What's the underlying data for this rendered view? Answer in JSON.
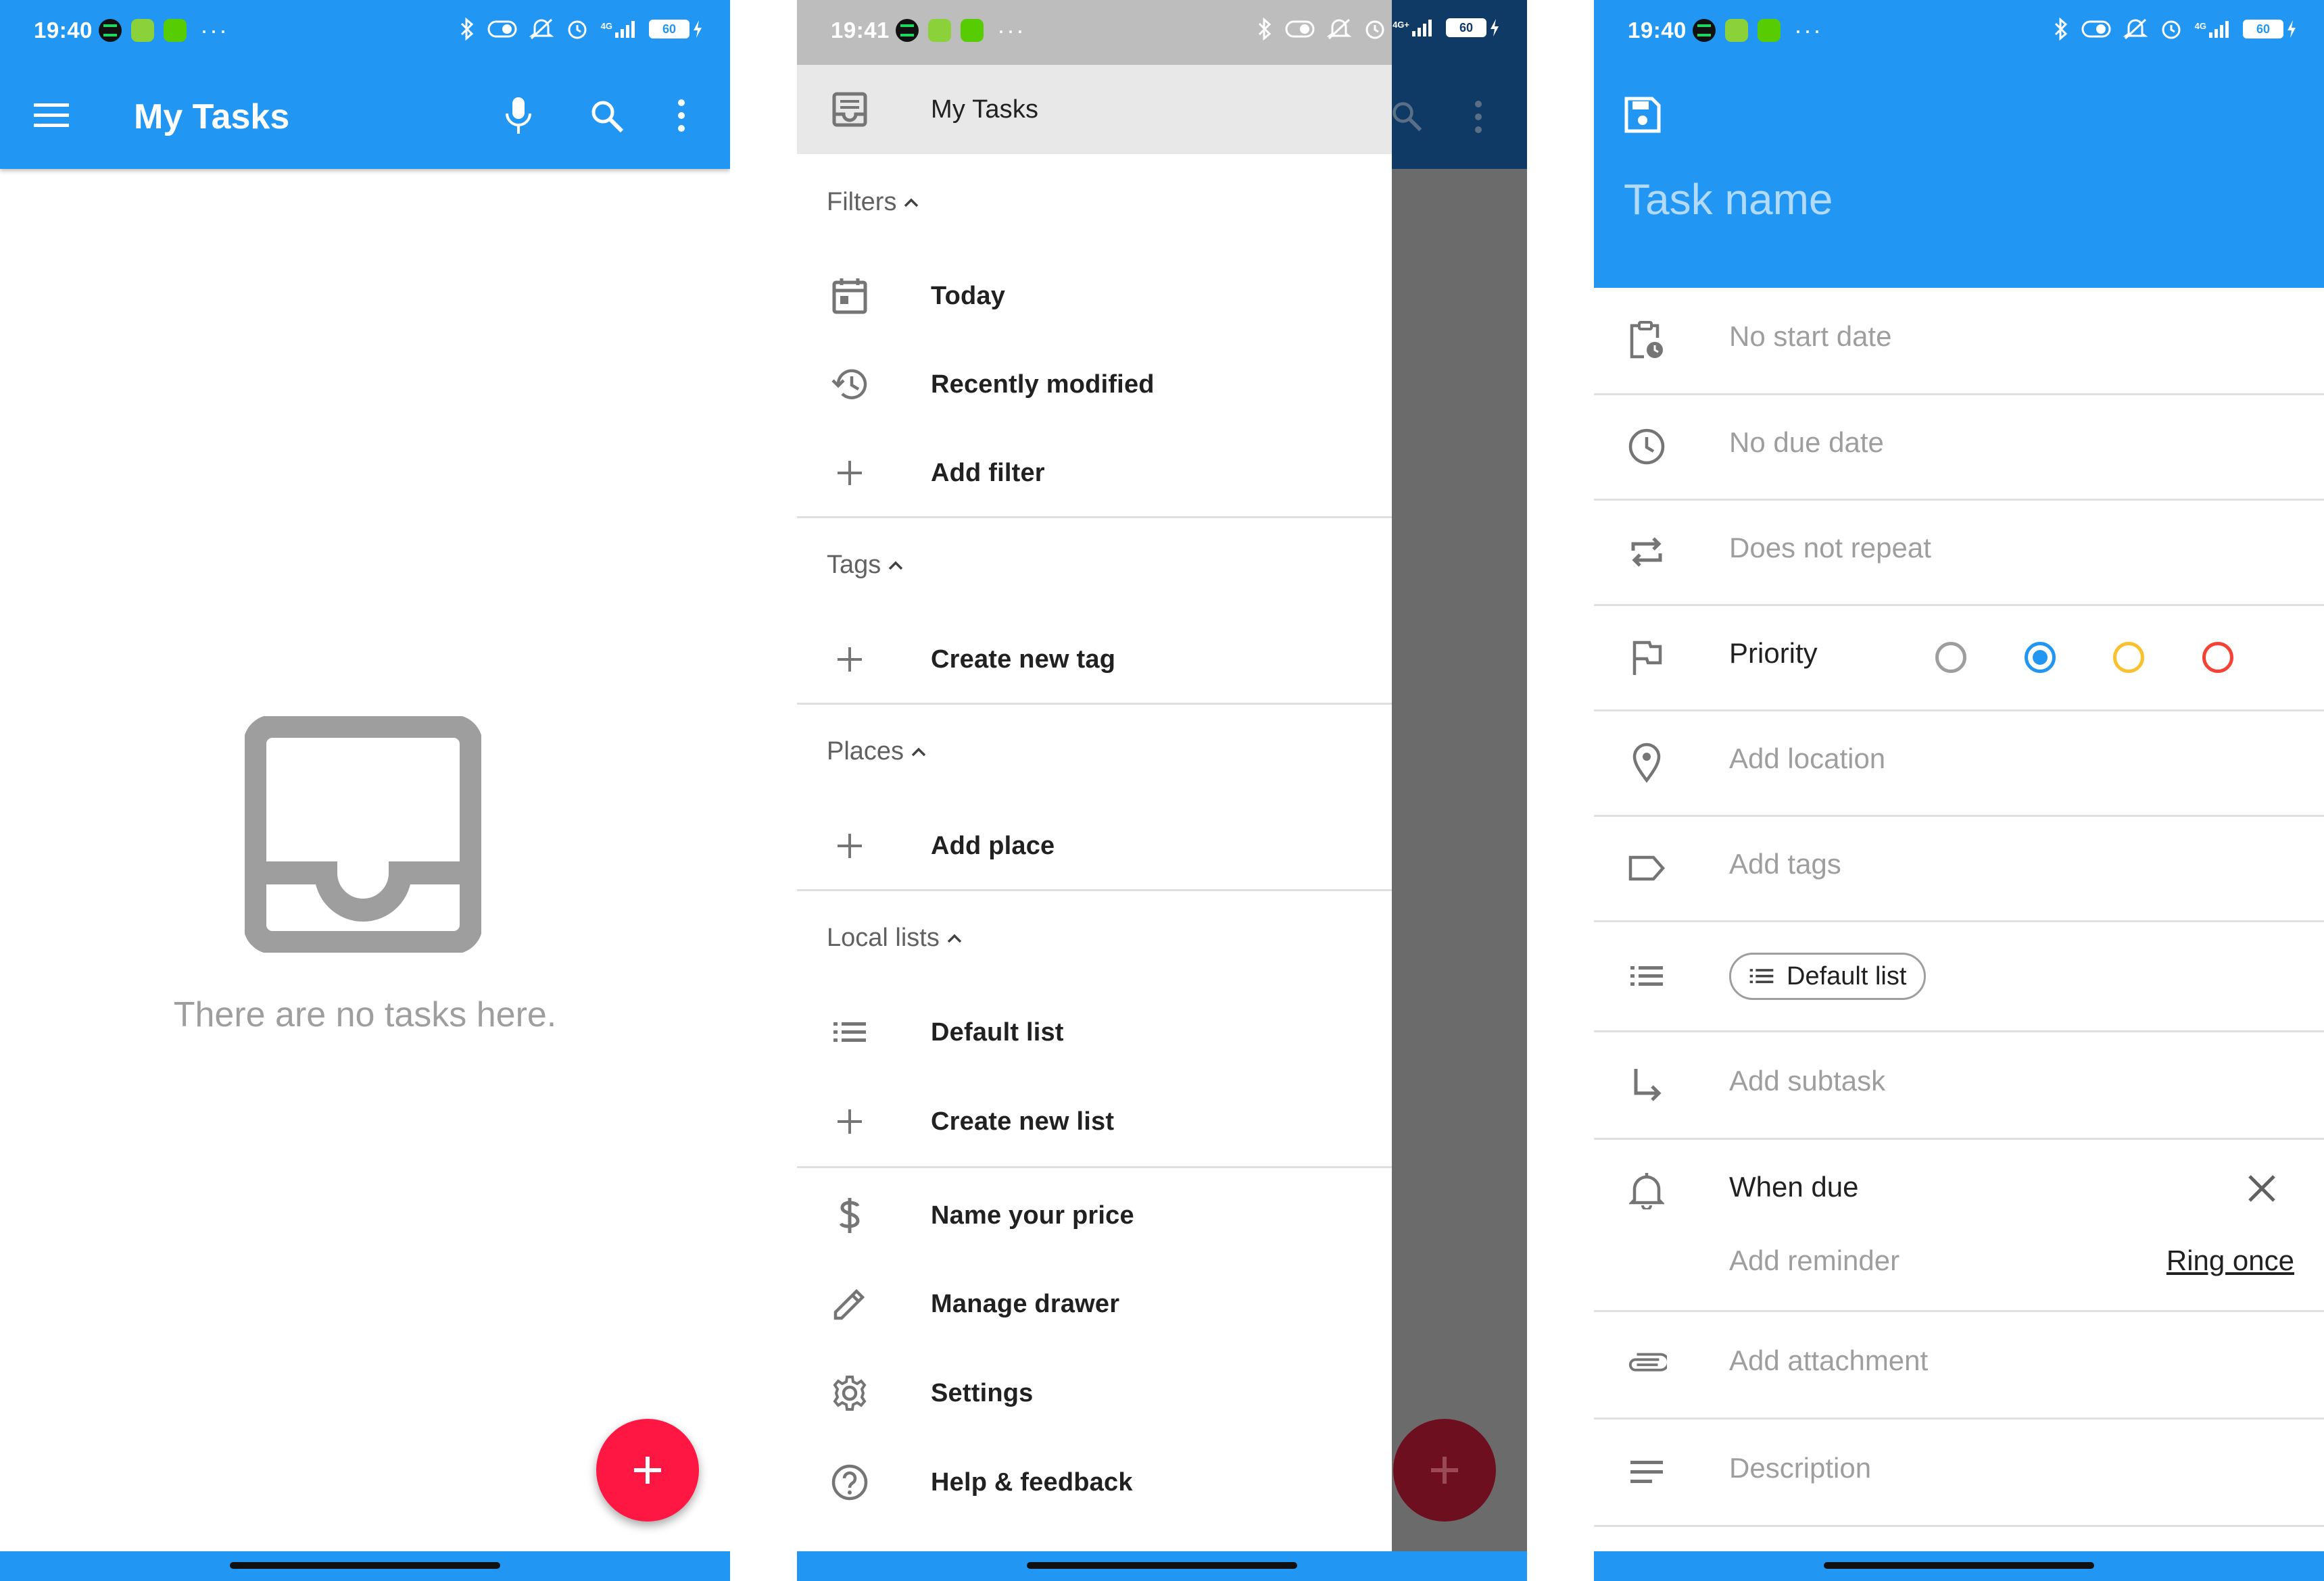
{
  "panel1": {
    "status": {
      "time": "19:40",
      "network": "4G",
      "battery": "60"
    },
    "appbar": {
      "title": "My Tasks"
    },
    "empty": {
      "message": "There are no tasks here."
    }
  },
  "panel2": {
    "status": {
      "time": "19:41",
      "network": "4G+",
      "battery": "60"
    },
    "drawer": {
      "header_item": "My Tasks",
      "filters": {
        "title": "Filters",
        "items": [
          "Today",
          "Recently modified",
          "Add filter"
        ]
      },
      "tags": {
        "title": "Tags",
        "items": [
          "Create new tag"
        ]
      },
      "places": {
        "title": "Places",
        "items": [
          "Add place"
        ]
      },
      "local_lists": {
        "title": "Local lists",
        "items": [
          "Default list",
          "Create new list"
        ]
      },
      "footer_items": [
        "Name your price",
        "Manage drawer",
        "Settings",
        "Help & feedback"
      ]
    }
  },
  "panel3": {
    "status": {
      "time": "19:40",
      "network": "4G",
      "battery": "60"
    },
    "task_name_placeholder": "Task name",
    "rows": {
      "start_date": "No start date",
      "due_date": "No due date",
      "repeat": "Does not repeat",
      "priority": "Priority",
      "location": "Add location",
      "tags": "Add tags",
      "list_chip": "Default list",
      "subtask": "Add subtask",
      "reminder": "When due",
      "add_reminder": "Add reminder",
      "ring": "Ring once",
      "attachment": "Add attachment",
      "description": "Description"
    },
    "priority_colors": [
      "#9e9e9e",
      "#2196f3",
      "#fbc02d",
      "#f44336"
    ],
    "priority_selected": 1
  },
  "colors": {
    "primary": "#2196f3",
    "fab": "#ff1744",
    "drawer_scrim": "#6b6b6b"
  }
}
